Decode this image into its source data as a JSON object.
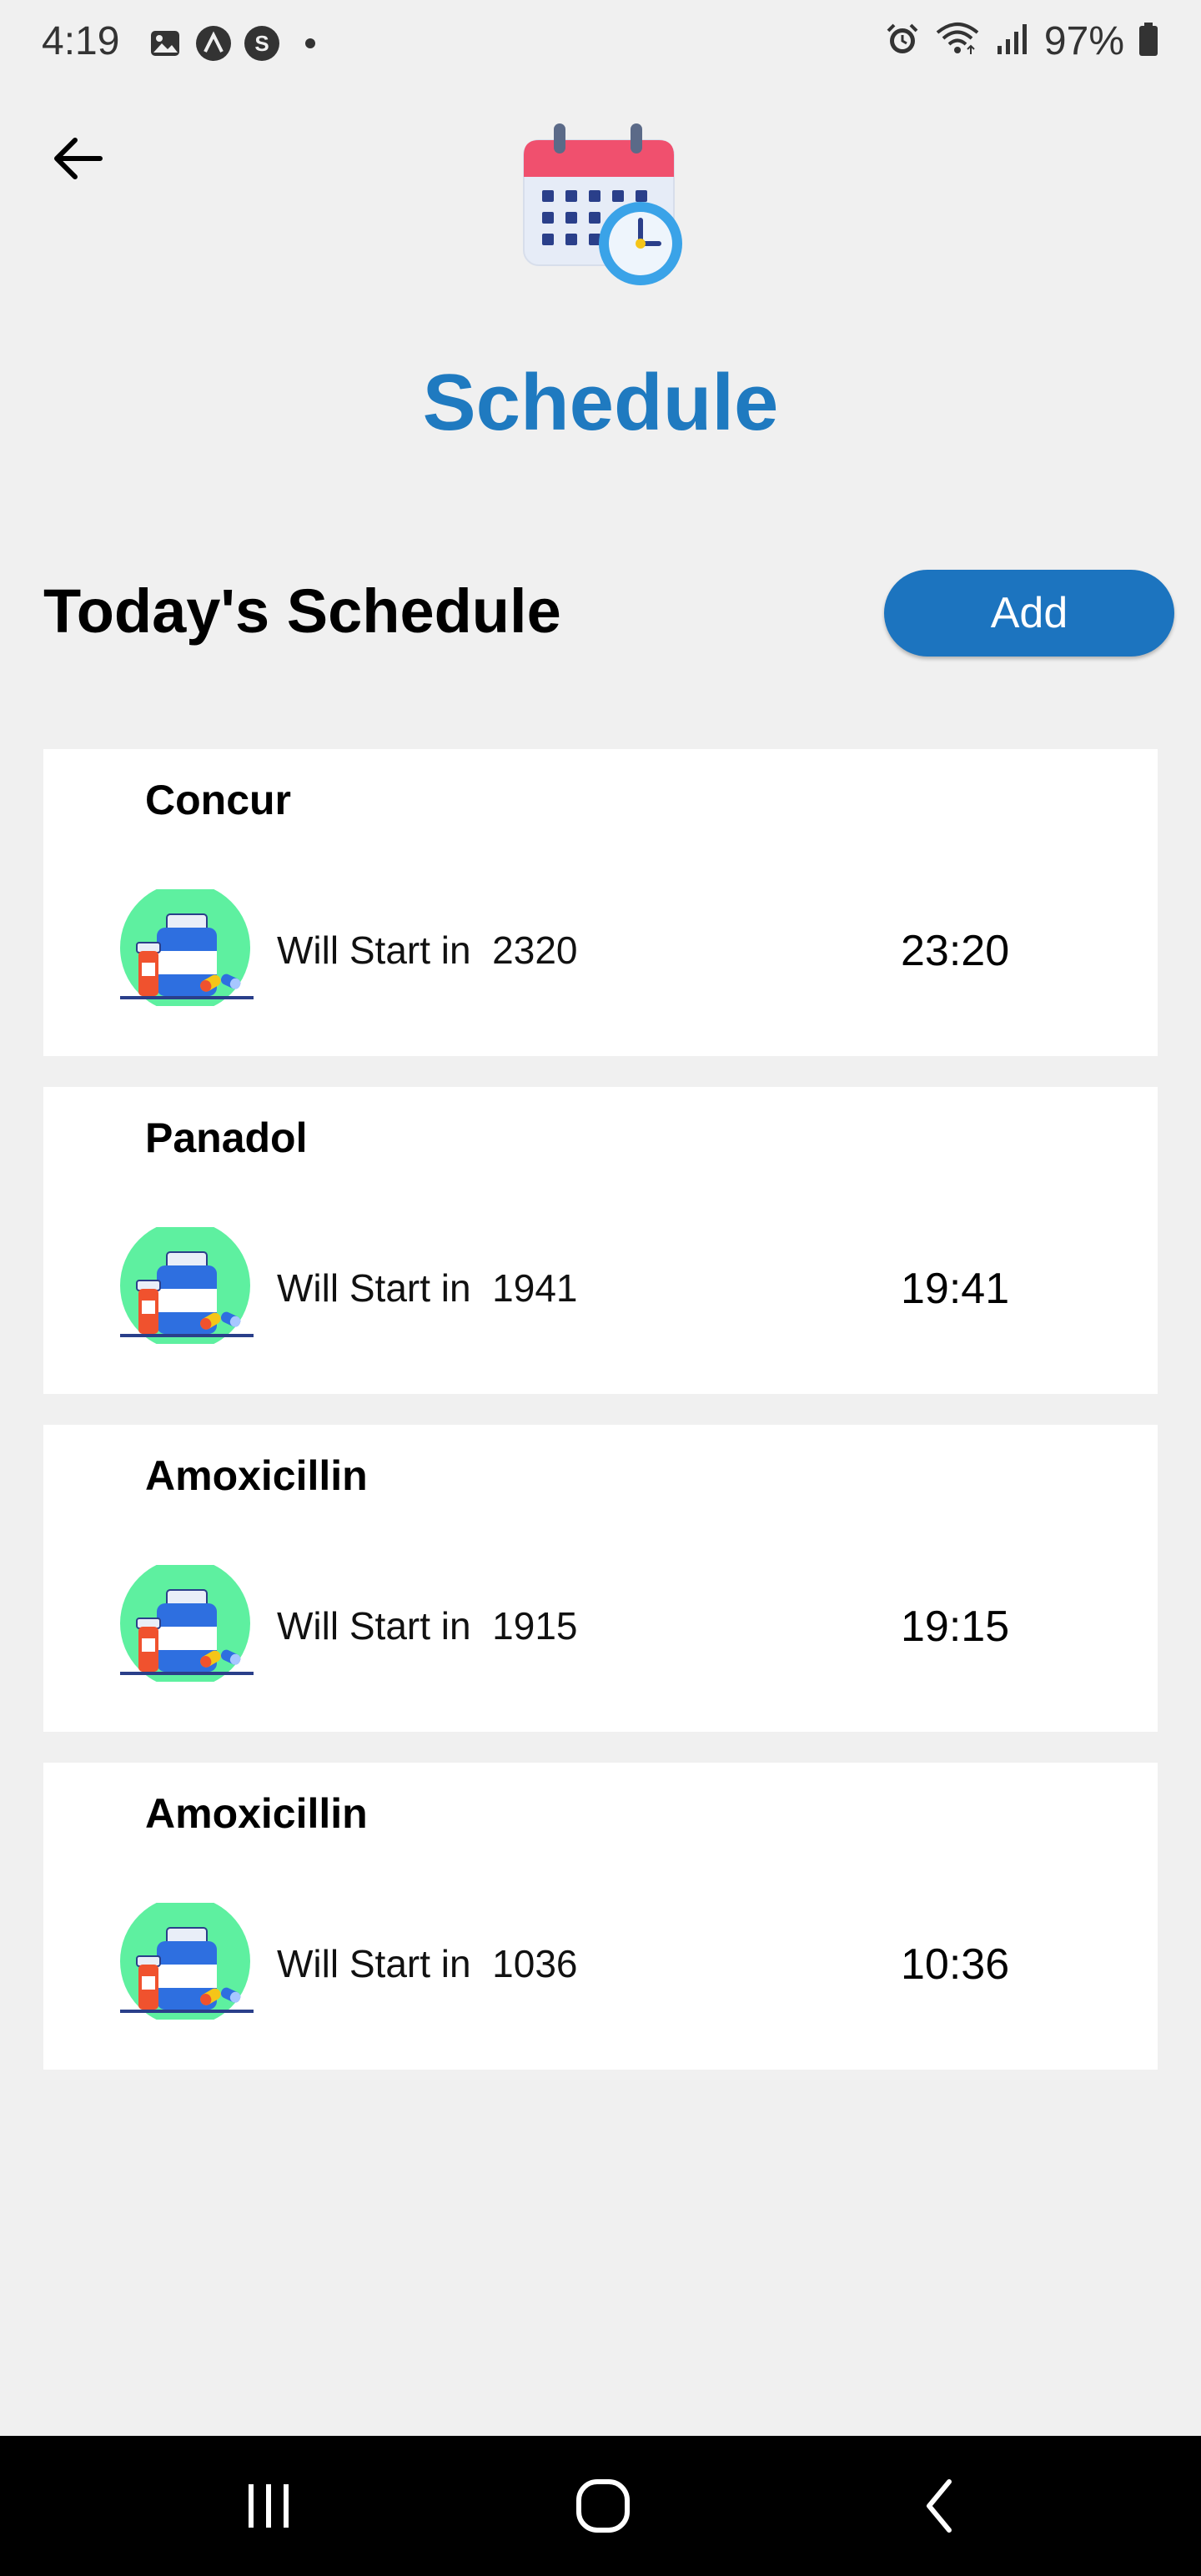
{
  "status_bar": {
    "time": "4:19",
    "battery": "97%",
    "left_icons": [
      "gallery-icon",
      "app-a-icon",
      "app-s-icon",
      "dot-icon"
    ],
    "right_icons": [
      "alarm-icon",
      "wifi-icon",
      "signal-icon",
      "battery-icon"
    ]
  },
  "header": {
    "title": "Schedule",
    "icon": "calendar-clock-icon"
  },
  "schedule": {
    "section_title": "Today's Schedule",
    "add_label": "Add",
    "items": [
      {
        "name": "Concur",
        "start_label": "Will Start in",
        "start_value": "2320",
        "time": "23:20"
      },
      {
        "name": "Panadol",
        "start_label": "Will Start in",
        "start_value": "1941",
        "time": "19:41"
      },
      {
        "name": "Amoxicillin",
        "start_label": "Will Start in",
        "start_value": "1915",
        "time": "19:15"
      },
      {
        "name": "Amoxicillin",
        "start_label": "Will Start in",
        "start_value": "1036",
        "time": "10:36"
      }
    ]
  },
  "colors": {
    "accent": "#1f7ac0",
    "button": "#1c74bf",
    "background": "#f0f0f0",
    "card": "#ffffff",
    "icon_circle": "#5ef0a0"
  }
}
